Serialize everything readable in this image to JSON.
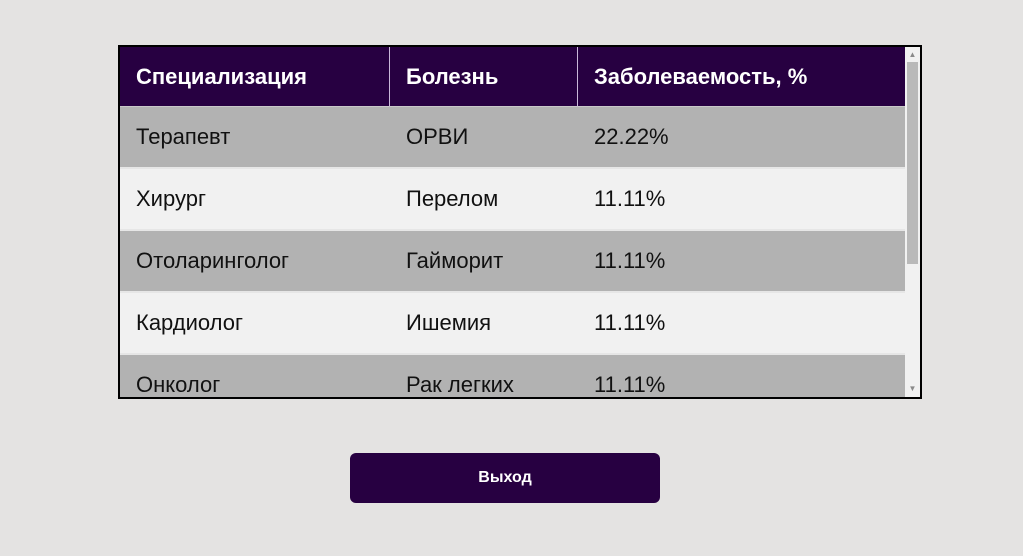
{
  "table": {
    "columns": [
      "Специализация",
      "Болезнь",
      "Заболеваемость, %"
    ],
    "rows": [
      [
        "Терапевт",
        "ОРВИ",
        "22.22%"
      ],
      [
        "Хирург",
        "Перелом",
        "11.11%"
      ],
      [
        "Отоларинголог",
        "Гайморит",
        "11.11%"
      ],
      [
        "Кардиолог",
        "Ишемия",
        "11.11%"
      ],
      [
        "Онколог",
        "Рак легких",
        "11.11%"
      ]
    ]
  },
  "scrollbar": {
    "up_icon": "triangle-up",
    "down_icon": "triangle-down",
    "up_glyph": "▲",
    "down_glyph": "▼"
  },
  "exit_button": {
    "label": "Выход"
  },
  "colors": {
    "header_bg": "#270041",
    "button_bg": "#270041",
    "row_odd": "#b2b2b2",
    "row_even": "#f1f1f1",
    "page_bg": "#e4e3e2"
  }
}
